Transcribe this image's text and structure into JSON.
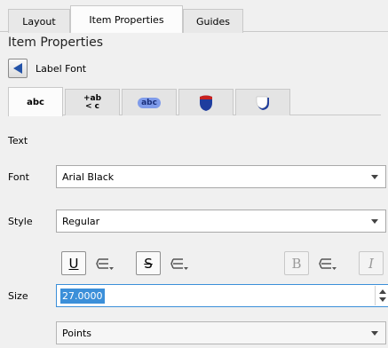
{
  "tabs": [
    "Layout",
    "Item Properties",
    "Guides"
  ],
  "panel": {
    "title": "Item Properties",
    "subtitle": "Label Font"
  },
  "icon_tabs": [
    {
      "name": "text-tab",
      "label": "abc"
    },
    {
      "name": "formatting-tab",
      "label_top": "+ab",
      "label_bottom": "< c"
    },
    {
      "name": "buffer-tab",
      "label": "abc"
    },
    {
      "name": "background-tab"
    },
    {
      "name": "shadow-tab"
    }
  ],
  "section": {
    "text_heading": "Text"
  },
  "font": {
    "label": "Font",
    "value": "Arial Black"
  },
  "style": {
    "label": "Style",
    "value": "Regular"
  },
  "format_buttons": {
    "underline": "U",
    "strike": "S",
    "bold": "B",
    "italic": "I"
  },
  "size": {
    "label": "Size",
    "value": "27.0000"
  },
  "unit": {
    "value": "Points"
  },
  "colors": {
    "accent": "#3b8fd9",
    "back_arrow": "#2453a8",
    "badge_blue": "#7f9bea",
    "shield_blue": "#1f3d9e",
    "shield_red": "#c8201e"
  }
}
